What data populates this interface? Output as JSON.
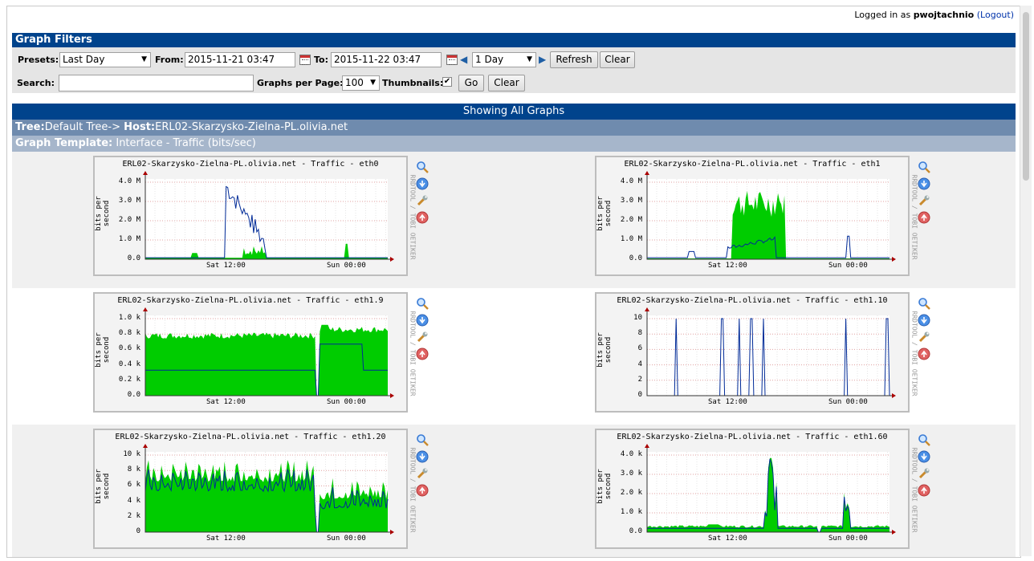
{
  "login": {
    "prefix": "Logged in as",
    "user": "pwojtachnio",
    "logout": "(Logout)"
  },
  "filters": {
    "title": "Graph Filters",
    "presets_label": "Presets:",
    "presets_value": "Last Day",
    "from_label": "From:",
    "from_value": "2015-11-21 03:47",
    "to_label": "To:",
    "to_value": "2015-11-22 03:47",
    "span_value": "1 Day",
    "refresh": "Refresh",
    "clear": "Clear",
    "search_label": "Search:",
    "search_value": "",
    "gpp_label": "Graphs per Page:",
    "gpp_value": "100",
    "thumbnails_label": "Thumbnails:",
    "thumbnails_checked": true,
    "go": "Go",
    "clear2": "Clear"
  },
  "showing": "Showing All Graphs",
  "tree": {
    "tree_label": "Tree:",
    "tree_value": "Default Tree->",
    "host_label": "Host:",
    "host_value": "ERL02-Skarzysko-Zielna-PL.olivia.net"
  },
  "template": {
    "label": "Graph Template:",
    "value": "Interface - Traffic (bits/sec)"
  },
  "graph_common": {
    "ylabel": "bits per second",
    "rrd": "RRDTOOL / TOBI OETIKER",
    "x_ticks": [
      "Sat 12:00",
      "Sun 00:00"
    ]
  },
  "graphs": [
    {
      "title": "ERL02-Skarzysko-Zielna-PL.olivia.net - Traffic - eth0",
      "y_ticks": [
        "4.0 M",
        "3.0 M",
        "2.0 M",
        "1.0 M",
        "0.0"
      ]
    },
    {
      "title": "ERL02-Skarzysko-Zielna-PL.olivia.net - Traffic - eth1",
      "y_ticks": [
        "4.0 M",
        "3.0 M",
        "2.0 M",
        "1.0 M",
        "0.0"
      ]
    },
    {
      "title": "ERL02-Skarzysko-Zielna-PL.olivia.net - Traffic - eth1.9",
      "y_ticks": [
        "1.0 k",
        "0.8 k",
        "0.6 k",
        "0.4 k",
        "0.2 k",
        "0.0"
      ]
    },
    {
      "title": "ERL02-Skarzysko-Zielna-PL.olivia.net - Traffic - eth1.10",
      "y_ticks": [
        "10",
        "8",
        "6",
        "4",
        "2",
        "0"
      ]
    },
    {
      "title": "ERL02-Skarzysko-Zielna-PL.olivia.net - Traffic - eth1.20",
      "y_ticks": [
        "10 k",
        "8 k",
        "6 k",
        "4 k",
        "2 k",
        "0"
      ]
    },
    {
      "title": "ERL02-Skarzysko-Zielna-PL.olivia.net - Traffic - eth1.60",
      "y_ticks": [
        "4.0 k",
        "3.0 k",
        "2.0 k",
        "1.0 k",
        "0.0"
      ]
    }
  ],
  "colors": {
    "header_blue": "#00438c",
    "inbound_fill": "#00cc00",
    "outbound_line": "#002a97",
    "grid_red": "#e0a0a0"
  },
  "icons": [
    "zoom-icon",
    "download-icon",
    "edit-icon",
    "top-icon"
  ]
}
